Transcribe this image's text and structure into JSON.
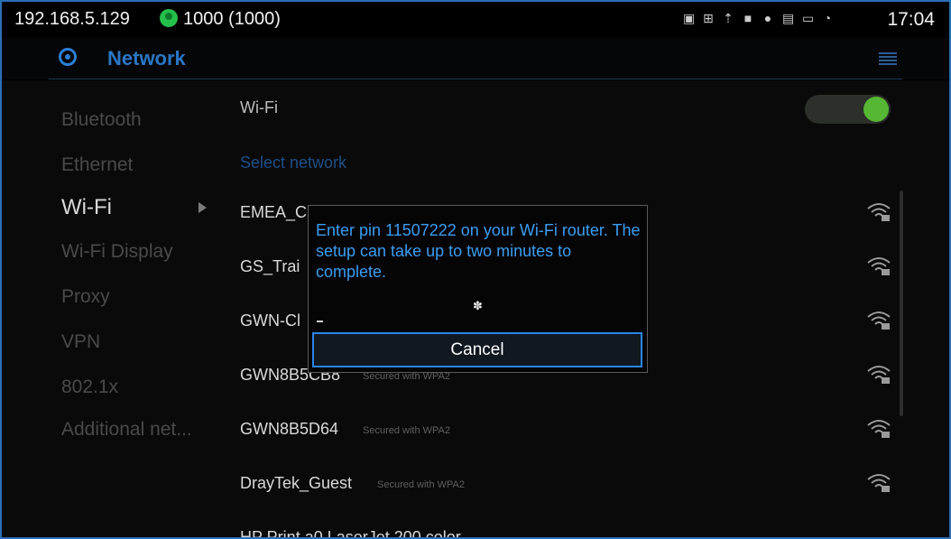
{
  "status": {
    "ip": "192.168.5.129",
    "account": "1000 (1000)",
    "time": "17:04",
    "icons": [
      "image-icon",
      "network-icon",
      "upload-icon",
      "lock-icon",
      "location-icon",
      "sim-icon",
      "monitor-icon",
      "wifi-x-icon"
    ]
  },
  "header": {
    "title": "Network"
  },
  "nav": {
    "items": [
      {
        "label": "Bluetooth"
      },
      {
        "label": "Ethernet"
      },
      {
        "label": "Wi-Fi"
      },
      {
        "label": "Wi-Fi Display"
      },
      {
        "label": "Proxy"
      },
      {
        "label": "VPN"
      },
      {
        "label": "802.1x"
      },
      {
        "label": "Additional net..."
      }
    ],
    "active": "Wi-Fi"
  },
  "wifi": {
    "label": "Wi-Fi",
    "enabled": true,
    "select_label": "Select network",
    "networks": [
      {
        "name": "EMEA_C",
        "security": ""
      },
      {
        "name": "GS_Trai",
        "security": ""
      },
      {
        "name": "GWN-Cl",
        "security": ""
      },
      {
        "name": "GWN8B5CB8",
        "security": "Secured with WPA2"
      },
      {
        "name": "GWN8B5D64",
        "security": "Secured with WPA2"
      },
      {
        "name": "DrayTek_Guest",
        "security": "Secured with WPA2"
      },
      {
        "name": "HP Print a0 LaserJet 200 color",
        "security": ""
      }
    ]
  },
  "dialog": {
    "message": "Enter pin 11507222 on your Wi-Fi router. The setup can take up to two minutes to complete.",
    "cancel_label": "Cancel"
  },
  "colors": {
    "accent": "#2a85e8",
    "toggle_on": "#55b733",
    "frame": "#2b6fb6"
  }
}
